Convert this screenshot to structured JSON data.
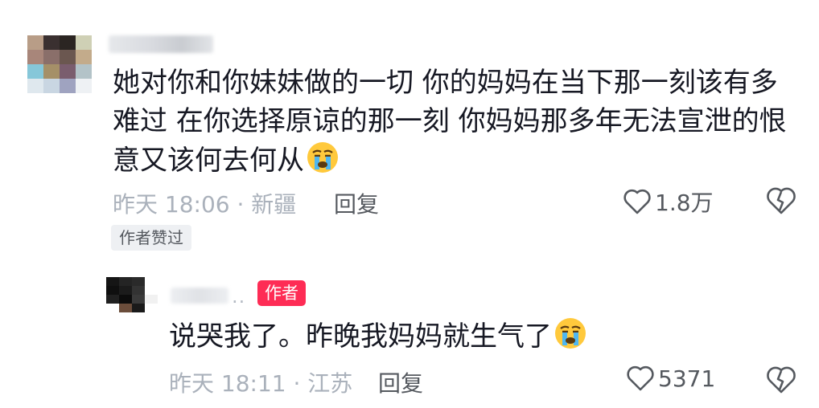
{
  "comment": {
    "text": "她对你和你妹妹做的一切 你的妈妈在当下那一刻该有多难过 在你选择原谅的那一刻 你妈妈那多年无法宣泄的恨意又该何去何从",
    "emoji": "crying-face",
    "time_location": "昨天 18:06 · 新疆",
    "reply_label": "回复",
    "likes": "1.8万",
    "author_liked_label": "作者赞过"
  },
  "reply": {
    "name_suffix": "..",
    "author_badge": "作者",
    "text": "说哭我了。昨晚我妈妈就生气了",
    "emoji": "crying-face",
    "time_location": "昨天 18:11 · 江苏",
    "reply_label": "回复",
    "likes": "5371"
  },
  "colors": {
    "accent": "#fe2c55",
    "text": "#161823",
    "meta": "#aab1bb"
  }
}
